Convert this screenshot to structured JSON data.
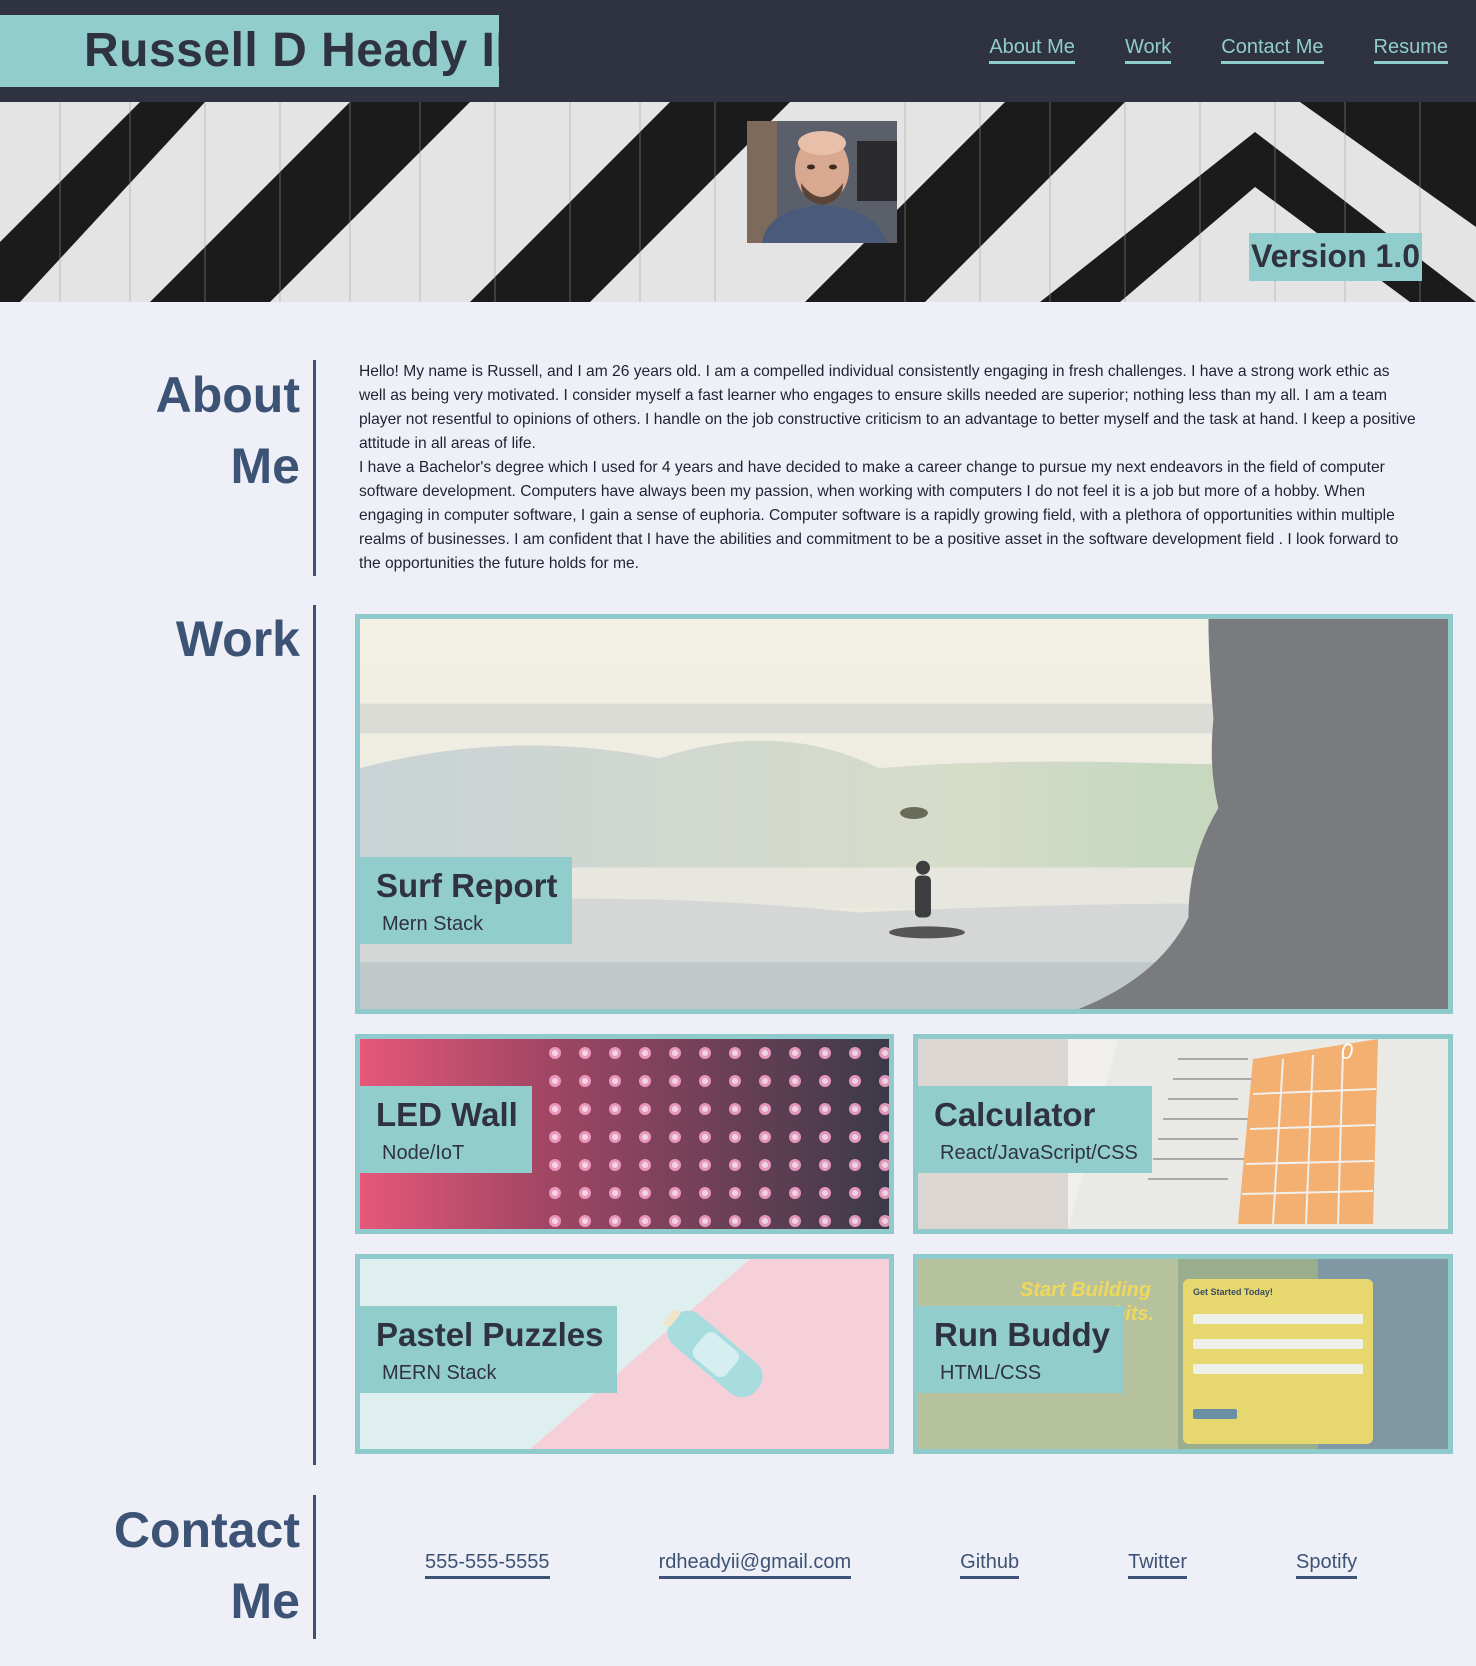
{
  "header": {
    "title": "Russell D Heady II",
    "nav": [
      {
        "label": "About Me"
      },
      {
        "label": "Work"
      },
      {
        "label": "Contact Me"
      },
      {
        "label": "Resume"
      }
    ]
  },
  "hero": {
    "version": "Version 1.0"
  },
  "about": {
    "title_line1": "About",
    "title_line2": "Me",
    "paragraph1": "Hello! My name is Russell, and I am 26 years old. I am a compelled individual consistently engaging in fresh challenges. I have a strong work ethic as well as being very motivated. I consider myself a fast learner who engages to ensure skills needed are superior; nothing less than my all. I am a team player not resentful to opinions of others. I handle on the job constructive criticism to an advantage to better myself and the task at hand. I keep a positive attitude in all areas of life.",
    "paragraph2": "I have a Bachelor's degree which I used for 4 years and have decided to make a career change to pursue my next endeavors in the field of computer software development. Computers have always been my passion, when working with computers I do not feel it is a job but more of a hobby. When engaging in computer software, I gain a sense of euphoria. Computer software is a rapidly growing field, with a plethora of opportunities within multiple realms of businesses. I am confident that I have the abilities and commitment to be a positive asset in the software development field . I look forward to the opportunities the future holds for me."
  },
  "work": {
    "title": "Work",
    "projects": [
      {
        "title": "Surf Report",
        "stack": "Mern Stack"
      },
      {
        "title": "LED Wall",
        "stack": "Node/IoT"
      },
      {
        "title": "Calculator",
        "stack": "React/JavaScript/CSS",
        "display": "0"
      },
      {
        "title": "Pastel Puzzles",
        "stack": "MERN Stack"
      },
      {
        "title": "Run Buddy",
        "stack": "HTML/CSS",
        "banner": "Start Building",
        "banner2": "bits.",
        "form_title": "Get Started Today!"
      }
    ]
  },
  "contact": {
    "title_line1": "Contact",
    "title_line2": "Me",
    "links": [
      {
        "label": "555-555-5555"
      },
      {
        "label": "rdheadyii@gmail.com"
      },
      {
        "label": "Github"
      },
      {
        "label": "Twitter"
      },
      {
        "label": "Spotify"
      }
    ]
  },
  "colors": {
    "header_bg": "#2f333f",
    "accent": "#92cdcd",
    "heading": "#3d5375",
    "page_bg": "#eeeff7"
  }
}
